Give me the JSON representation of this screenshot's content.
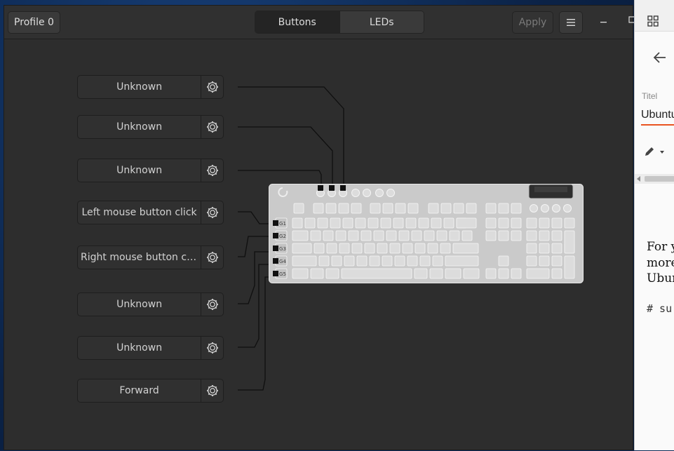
{
  "app": {
    "profile_label": "Profile 0",
    "tabs": [
      {
        "label": "Buttons",
        "active": true
      },
      {
        "label": "LEDs",
        "active": false
      }
    ],
    "apply_label": "Apply",
    "menu_icon": "hamburger-icon",
    "window_controls": {
      "minimize": "minimize-icon",
      "maximize": "maximize-icon"
    }
  },
  "buttons": [
    {
      "label": "Unknown",
      "target": "M1"
    },
    {
      "label": "Unknown",
      "target": "M2"
    },
    {
      "label": "Unknown",
      "target": "M3"
    },
    {
      "label": "Left mouse button click",
      "target": "G1"
    },
    {
      "label": "Right mouse button cl…",
      "target": "G2"
    },
    {
      "label": "Unknown",
      "target": "G3"
    },
    {
      "label": "Unknown",
      "target": "G4"
    },
    {
      "label": "Forward",
      "target": "G5"
    }
  ],
  "keyboard": {
    "macro_keys": [
      "M1",
      "M2",
      "M3"
    ],
    "g_keys": [
      "G1",
      "G2",
      "G3",
      "G4",
      "G5"
    ]
  },
  "side_panel": {
    "label": "Titel",
    "title_value": "Ubuntu",
    "text_lines": [
      "For y",
      "more",
      "Ubur"
    ],
    "code_line": "# su"
  },
  "colors": {
    "accent_underline": "#e95420",
    "keyboard_body": "#c9c9c9",
    "wire": "#0f0f0f"
  }
}
